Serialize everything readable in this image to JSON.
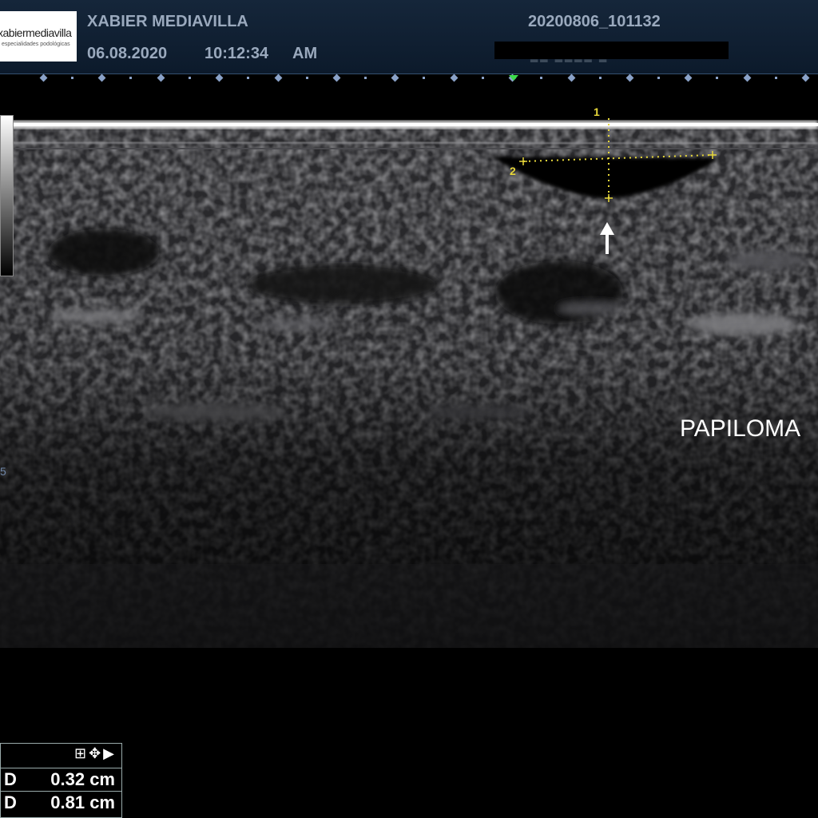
{
  "header": {
    "logo": {
      "main": "xabiermediavilla",
      "sub": "especialidades podológicas"
    },
    "operator_name": "XABIER MEDIAVILLA",
    "date": "06.08.2020",
    "time": "10:12:34",
    "ampm": "AM",
    "study_id": "20200806_101132"
  },
  "image": {
    "annotation": "PAPILOMA",
    "depth_mark": "5",
    "caliper_labels": [
      "1",
      "2"
    ]
  },
  "measurements": {
    "toolbar_icons": [
      "grid-icon",
      "move-icon",
      "play-icon"
    ],
    "rows": [
      {
        "label": "D",
        "value": "0.32 cm"
      },
      {
        "label": "D",
        "value": "0.81 cm"
      }
    ]
  },
  "colors": {
    "caliper": "#e8d83a",
    "header_text": "#9aa9bd",
    "focus_marker": "#3cdc4a"
  }
}
